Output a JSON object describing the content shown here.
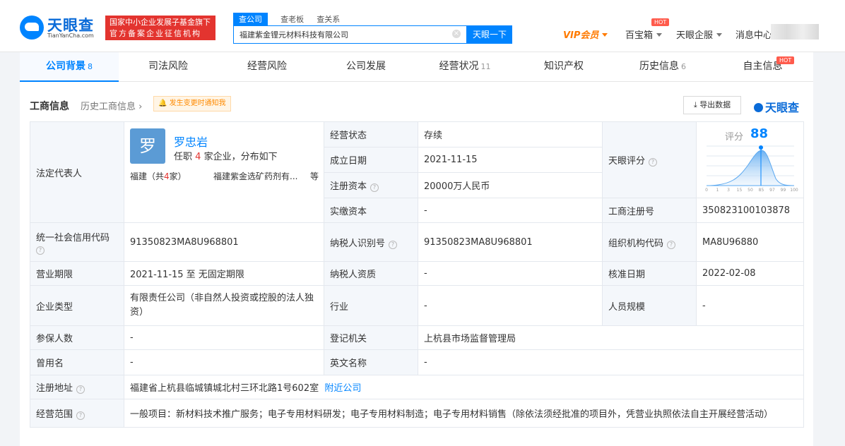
{
  "header": {
    "logo_text": "天眼查",
    "logo_sub": "TianYanCha.com",
    "badge_line1": "国家中小企业发展子基金旗下",
    "badge_line2": "官方备案企业征信机构",
    "search_tabs": [
      "查公司",
      "查老板",
      "查关系"
    ],
    "search_value": "福建紫金锂元材料科技有限公司",
    "search_button": "天眼一下",
    "vip": "VIP会员",
    "baibaoxiang": "百宝箱",
    "tianyan_qifu": "天眼企服",
    "message_center": "消息中心",
    "hot": "HOT"
  },
  "tabs": [
    {
      "label": "公司背景",
      "count": "8"
    },
    {
      "label": "司法风险",
      "count": ""
    },
    {
      "label": "经营风险",
      "count": ""
    },
    {
      "label": "公司发展",
      "count": ""
    },
    {
      "label": "经营状况",
      "count": "11"
    },
    {
      "label": "知识产权",
      "count": ""
    },
    {
      "label": "历史信息",
      "count": "6"
    },
    {
      "label": "自主信息",
      "count": ""
    }
  ],
  "section": {
    "title": "工商信息",
    "history": "历史工商信息",
    "notify": "发生变更时通知我",
    "export": "导出数据",
    "brand": "天眼查"
  },
  "rep": {
    "avatar_char": "罗",
    "name": "罗忠岩",
    "roles_prefix": "任职",
    "roles_count": "4",
    "roles_suffix": "家企业，分布如下",
    "prov_prefix": "福建（共",
    "prov_count": "4",
    "prov_suffix": "家）",
    "company": "福建紫金选矿药剂有...",
    "etc": "等"
  },
  "score": {
    "label": "评分",
    "value": "88",
    "ticks": [
      "0",
      "1",
      "3",
      "15",
      "50",
      "85",
      "97",
      "99",
      "100"
    ]
  },
  "rows": {
    "legal_rep": "法定代表人",
    "status_lbl": "经营状态",
    "status": "存续",
    "found_lbl": "成立日期",
    "found": "2021-11-15",
    "capital_lbl": "注册资本",
    "capital": "20000万人民币",
    "paid_lbl": "实缴资本",
    "paid": "-",
    "tianyan_score_lbl": "天眼评分",
    "regno_lbl": "工商注册号",
    "regno": "350823100103878",
    "credit_lbl": "统一社会信用代码",
    "credit": "91350823MA8U968801",
    "taxid_lbl": "纳税人识别号",
    "taxid": "91350823MA8U968801",
    "org_lbl": "组织机构代码",
    "org": "MA8U96880",
    "term_lbl": "营业期限",
    "term": "2021-11-15  至 无固定期限",
    "taxq_lbl": "纳税人资质",
    "taxq": "-",
    "approve_lbl": "核准日期",
    "approve": "2022-02-08",
    "type_lbl": "企业类型",
    "type": "有限责任公司（非自然人投资或控股的法人独资）",
    "industry_lbl": "行业",
    "industry": "-",
    "staff_lbl": "人员规模",
    "staff": "-",
    "insured_lbl": "参保人数",
    "insured": "-",
    "authority_lbl": "登记机关",
    "authority": "上杭县市场监督管理局",
    "former_lbl": "曾用名",
    "former": "-",
    "en_lbl": "英文名称",
    "en": "-",
    "addr_lbl": "注册地址",
    "addr": "福建省上杭县临城镇城北村三环北路1号602室",
    "nearby": "附近公司",
    "scope_lbl": "经营范围",
    "scope": "一般项目：新材料技术推广服务；电子专用材料研发；电子专用材料制造；电子专用材料销售（除依法须经批准的项目外，凭营业执照依法自主开展经营活动）"
  }
}
